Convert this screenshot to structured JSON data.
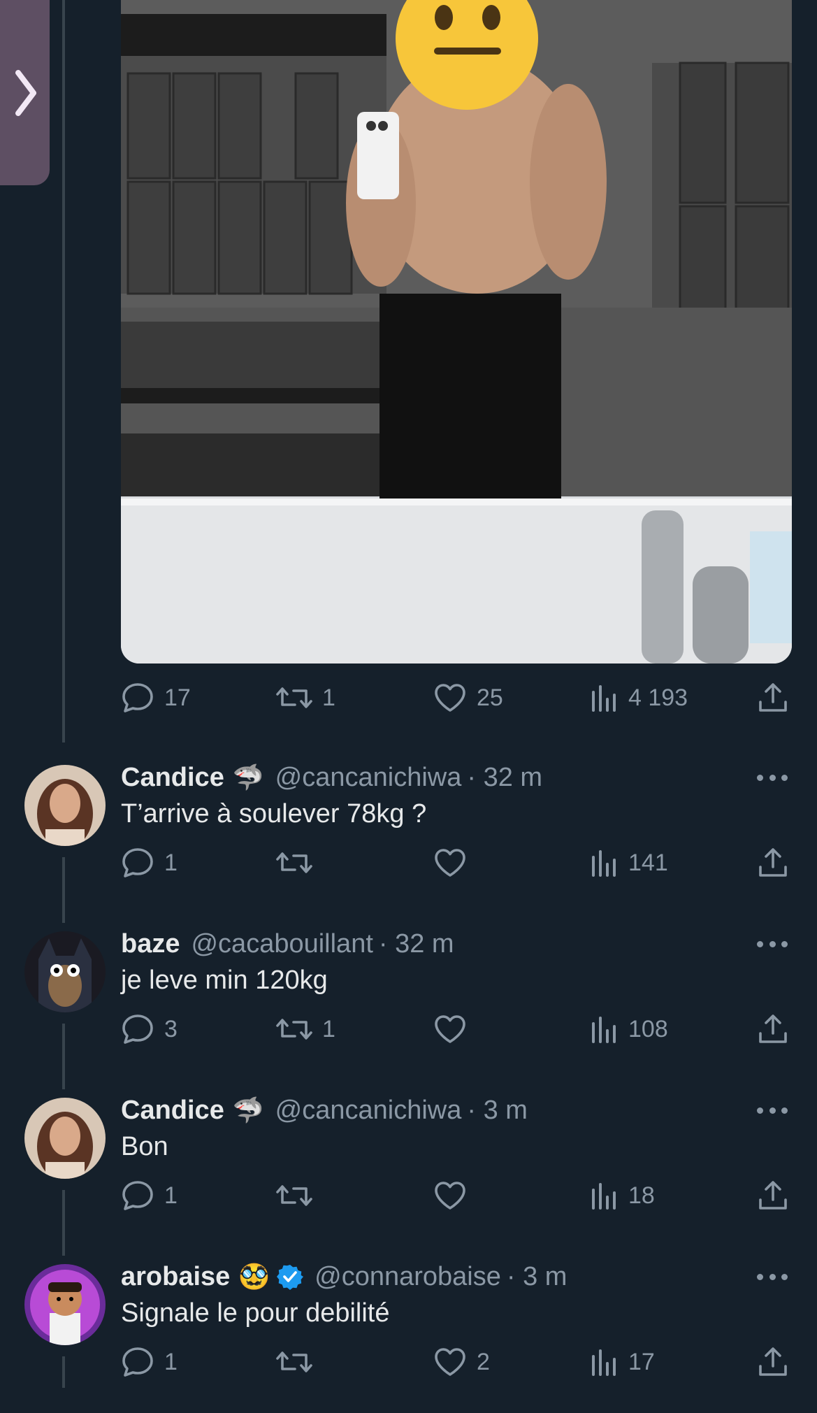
{
  "main_tweet": {
    "media_alt": "",
    "actions": {
      "replies": "17",
      "retweets": "1",
      "likes": "25",
      "views": "4 193"
    }
  },
  "replies": [
    {
      "name": "Candice",
      "badge_emoji": "🦈",
      "verified": false,
      "handle": "@cancanichiwa",
      "time": "· 32 m",
      "text": "T’arrive à soulever 78kg ?",
      "replies": "1",
      "retweets": "",
      "likes": "",
      "views": "141"
    },
    {
      "name": "baze",
      "badge_emoji": "",
      "verified": false,
      "handle": "@cacabouillant",
      "time": "· 32 m",
      "text": "je leve min 120kg",
      "replies": "3",
      "retweets": "1",
      "likes": "",
      "views": "108"
    },
    {
      "name": "Candice",
      "badge_emoji": "🦈",
      "verified": false,
      "handle": "@cancanichiwa",
      "time": "· 3 m",
      "text": "Bon",
      "replies": "1",
      "retweets": "",
      "likes": "",
      "views": "18"
    },
    {
      "name": "arobaise",
      "badge_emoji": "🥸",
      "verified": true,
      "handle": "@connarobaise",
      "time": "· 3 m",
      "text": "Signale le pour debilité",
      "replies": "1",
      "retweets": "",
      "likes": "2",
      "views": "17"
    }
  ],
  "colors": {
    "background": "#15202b",
    "muted": "#8b98a5",
    "text": "#e7e9ea",
    "verified": "#1d9bf0"
  }
}
